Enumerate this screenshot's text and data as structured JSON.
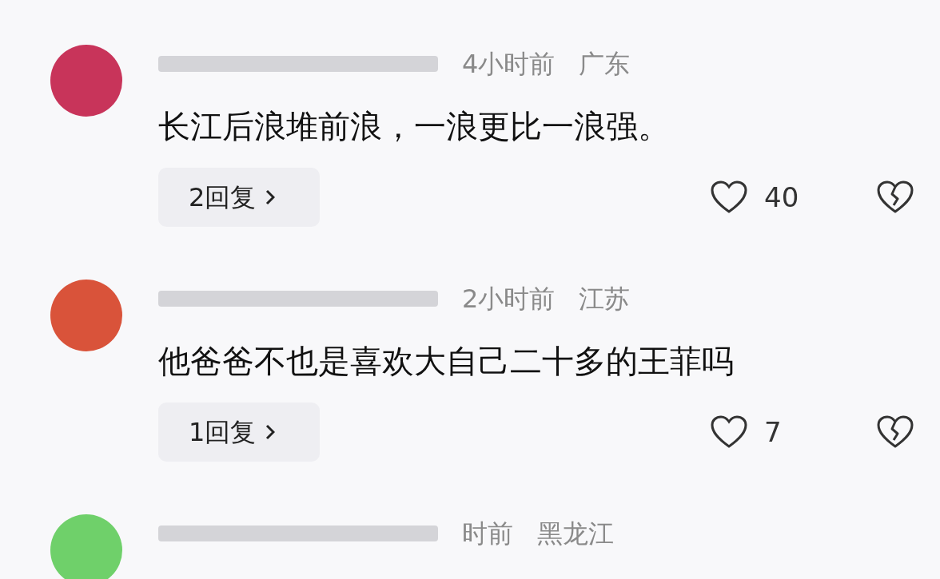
{
  "comments": [
    {
      "color": "#c8345a",
      "time": "4小时前",
      "location": "广东",
      "text": "长江后浪堆前浪，一浪更比一浪强。",
      "replies": "2回复",
      "likes": "40"
    },
    {
      "color": "#d9533a",
      "time": "2小时前",
      "location": "江苏",
      "text": "他爸爸不也是喜欢大自己二十多的王菲吗",
      "replies": "1回复",
      "likes": "7"
    },
    {
      "color": "#6fd06a",
      "time": "时前",
      "location": "黑龙江"
    }
  ]
}
